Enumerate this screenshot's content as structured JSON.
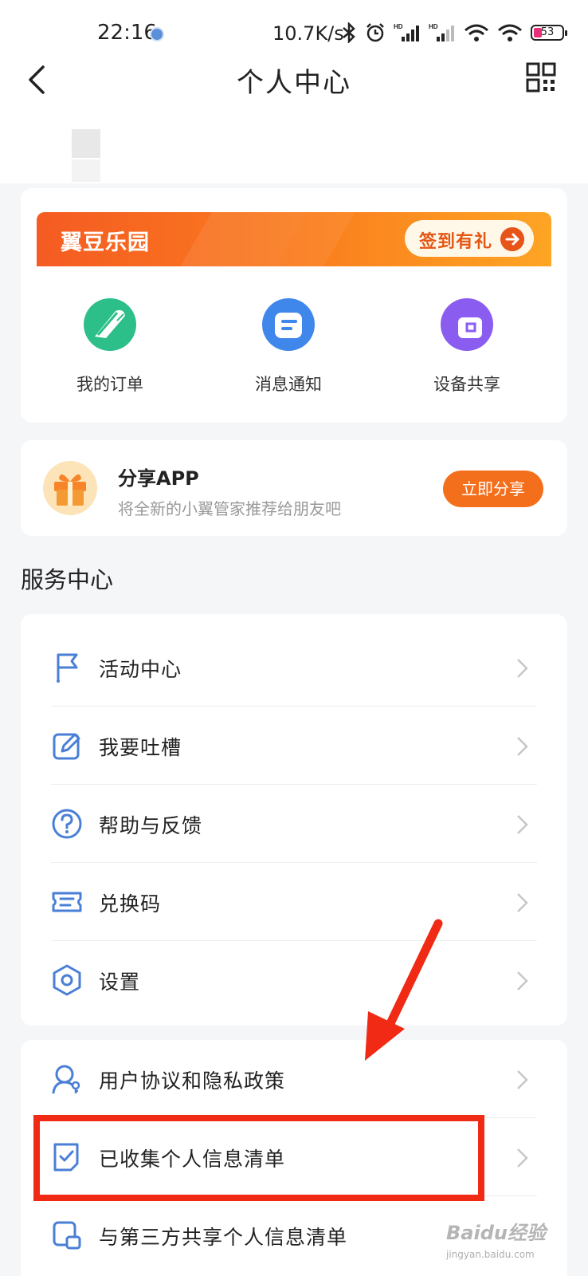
{
  "status_bar": {
    "time": "22:16",
    "net_speed": "10.7K/s",
    "battery": "53",
    "icons": [
      "bluetooth-icon",
      "alarm-icon",
      "hd-signal-icon",
      "hd-signal-icon",
      "wifi-icon",
      "wifi-icon",
      "battery-icon"
    ]
  },
  "nav": {
    "title": "个人中心",
    "back_icon": "back-chevron-icon",
    "qr_icon": "qr-code-icon"
  },
  "banner": {
    "title": "翼豆乐园",
    "button_label": "签到有礼",
    "colors": {
      "start": "#f55b22",
      "end": "#fda524"
    }
  },
  "quick_actions": [
    {
      "label": "我的订单",
      "icon": "orders-icon",
      "color": "#2dbf8a"
    },
    {
      "label": "消息通知",
      "icon": "message-icon",
      "color": "#3f87ea"
    },
    {
      "label": "设备共享",
      "icon": "device-share-icon",
      "color": "#8a5cf0"
    }
  ],
  "share": {
    "title": "分享APP",
    "subtitle": "将全新的小翼管家推荐给朋友吧",
    "button_label": "立即分享",
    "icon": "gift-icon"
  },
  "service_center": {
    "title": "服务中心",
    "items": [
      {
        "label": "活动中心",
        "icon": "flag-icon"
      },
      {
        "label": "我要吐槽",
        "icon": "edit-icon"
      },
      {
        "label": "帮助与反馈",
        "icon": "help-icon"
      },
      {
        "label": "兑换码",
        "icon": "ticket-icon"
      },
      {
        "label": "设置",
        "icon": "settings-icon"
      }
    ]
  },
  "legal": {
    "items": [
      {
        "label": "用户协议和隐私政策",
        "icon": "user-privacy-icon"
      },
      {
        "label": "已收集个人信息清单",
        "icon": "checklist-icon"
      },
      {
        "label": "与第三方共享个人信息清单",
        "icon": "share-list-icon"
      }
    ]
  },
  "watermark": {
    "main": "Baidu经验",
    "sub": "jingyan.baidu.com"
  },
  "accent_color": "#4a7fd6"
}
